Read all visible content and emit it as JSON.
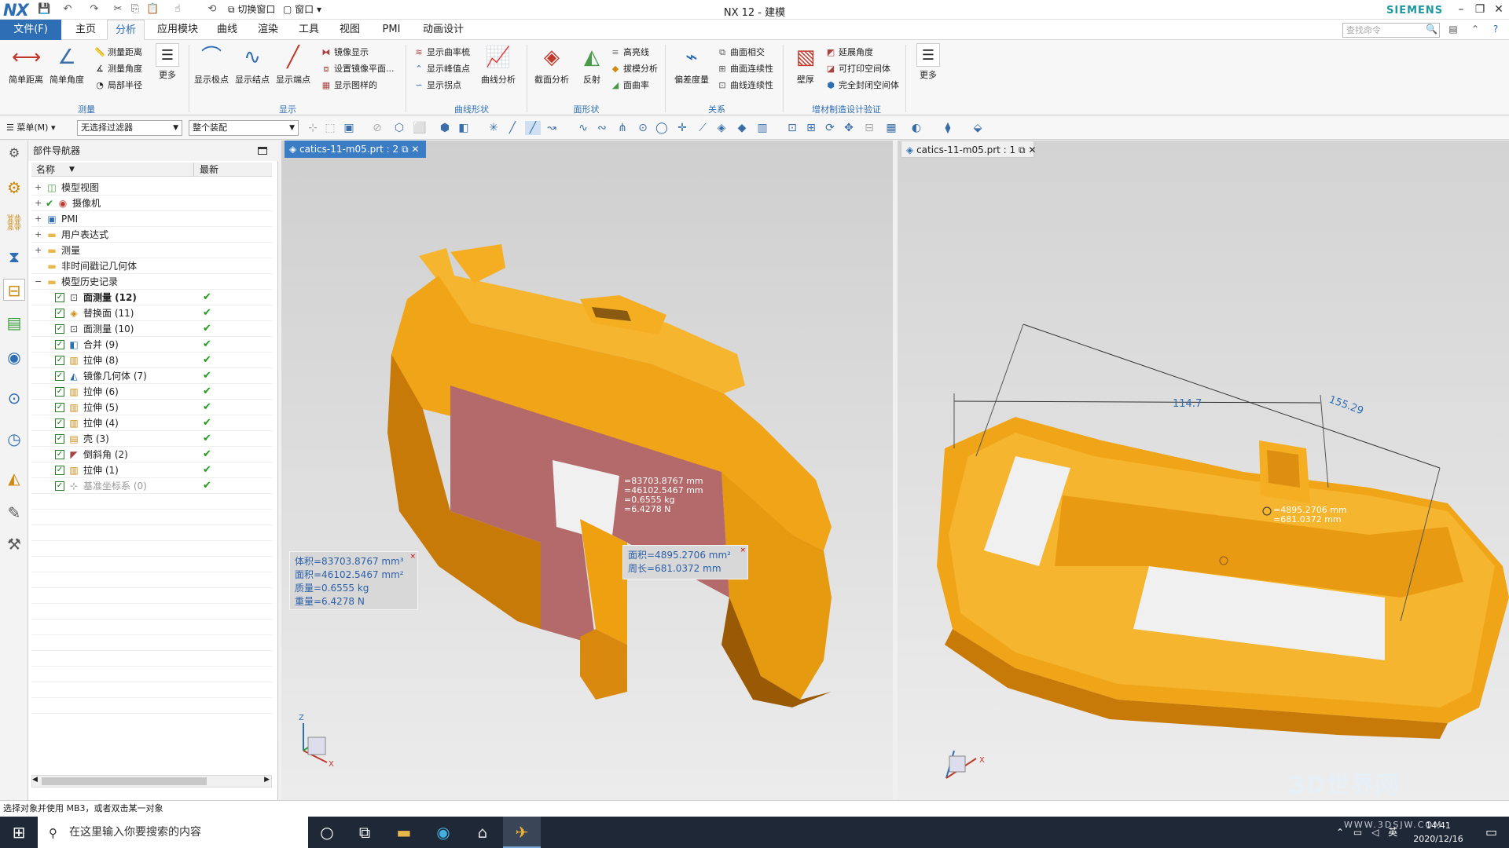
{
  "app": {
    "logo": "NX",
    "title": "NX 12 - 建模",
    "brand": "SIEMENS",
    "window_label": "窗口",
    "switch_window": "切换窗口"
  },
  "menu": {
    "file": "文件(F)",
    "tabs": [
      "主页",
      "分析",
      "应用模块",
      "曲线",
      "渲染",
      "工具",
      "视图",
      "PMI",
      "动画设计"
    ],
    "active_tab": "分析",
    "search_placeholder": "查找命令"
  },
  "ribbon": {
    "measure_group": {
      "label": "测量",
      "big": [
        "简单距离",
        "简单角度",
        "更多"
      ],
      "small": [
        "测量距离",
        "测量角度",
        "局部半径"
      ]
    },
    "display_group": {
      "label": "显示",
      "big": [
        "显示极点",
        "显示结点",
        "显示端点"
      ],
      "small": [
        "镜像显示",
        "设置镜像平面...",
        "显示图样的"
      ]
    },
    "curve_shape_group": {
      "label": "曲线形状",
      "small": [
        "显示曲率梳",
        "显示峰值点",
        "显示拐点"
      ],
      "big": [
        "曲线分析"
      ]
    },
    "face_shape_group": {
      "label": "面形状",
      "big": [
        "截面分析",
        "反射"
      ],
      "small": [
        "高亮线",
        "拔模分析",
        "面曲率"
      ]
    },
    "relation_group": {
      "label": "关系",
      "big": [
        "偏差度量"
      ],
      "small": [
        "曲面相交",
        "曲面连续性",
        "曲线连续性"
      ]
    },
    "additive_group": {
      "label": "增材制造设计验证",
      "big": [
        "壁厚"
      ],
      "small": [
        "延展角度",
        "可打印空间体",
        "完全封闭空间体"
      ]
    },
    "more_label": "更多"
  },
  "toolbar2": {
    "menu_btn": "菜单(M)",
    "filter": "无选择过滤器",
    "assembly": "整个装配"
  },
  "nav": {
    "title": "部件导航器",
    "col_name": "名称",
    "col_latest": "最新",
    "root_items": [
      {
        "label": "模型视图",
        "icon": "views-icon"
      },
      {
        "label": "摄像机",
        "icon": "camera-icon"
      },
      {
        "label": "PMI",
        "icon": "pmi-icon"
      },
      {
        "label": "用户表达式",
        "icon": "folder-icon"
      },
      {
        "label": "测量",
        "icon": "folder-icon"
      },
      {
        "label": "非时间戳记几何体",
        "icon": "folder-icon"
      },
      {
        "label": "模型历史记录",
        "icon": "folder-icon"
      }
    ],
    "history": [
      {
        "label": "面测量 (12)",
        "icon": "measure-face-icon",
        "bold": true
      },
      {
        "label": "替换面 (11)",
        "icon": "replace-face-icon"
      },
      {
        "label": "面测量 (10)",
        "icon": "measure-face-icon"
      },
      {
        "label": "合并 (9)",
        "icon": "unite-icon"
      },
      {
        "label": "拉伸 (8)",
        "icon": "extrude-icon"
      },
      {
        "label": "镜像几何体 (7)",
        "icon": "mirror-icon"
      },
      {
        "label": "拉伸 (6)",
        "icon": "extrude-icon"
      },
      {
        "label": "拉伸 (5)",
        "icon": "extrude-icon"
      },
      {
        "label": "拉伸 (4)",
        "icon": "extrude-icon"
      },
      {
        "label": "壳 (3)",
        "icon": "shell-icon"
      },
      {
        "label": "倒斜角 (2)",
        "icon": "chamfer-icon"
      },
      {
        "label": "拉伸 (1)",
        "icon": "extrude-icon"
      },
      {
        "label": "基准坐标系 (0)",
        "icon": "datum-csys-icon",
        "greyed": true
      }
    ]
  },
  "viewport1": {
    "tab": "catics-11-m05.prt : 2",
    "body_info": [
      "体积=83703.8767 mm³",
      "面积=46102.5467 mm²",
      "质量=0.6555 kg",
      "重量=6.4278 N"
    ],
    "ghost_info": [
      "=83703.8767 mm",
      "=46102.5467 mm",
      "=0.6555 kg",
      "=6.4278 N"
    ],
    "face_info": [
      "面积=4895.2706 mm²",
      "周长=681.0372 mm"
    ],
    "colors": {
      "body": "#f0a418",
      "face": "#b46a6a"
    }
  },
  "viewport2": {
    "tab": "catics-11-m05.prt : 1",
    "dim_a": "114.7",
    "dim_b": "155.29",
    "face_info": [
      "=4895.2706 mm",
      "=681.0372 mm"
    ]
  },
  "status": {
    "text": "选择对象并使用 MB3，或者双击某一对象"
  },
  "taskbar": {
    "search": "在这里输入你要搜索的内容",
    "time": "14:41",
    "date": "2020/12/16",
    "lang": "英"
  },
  "watermark": {
    "main": "3D世界网",
    "sub": "WWW.3DSJW.COM"
  }
}
